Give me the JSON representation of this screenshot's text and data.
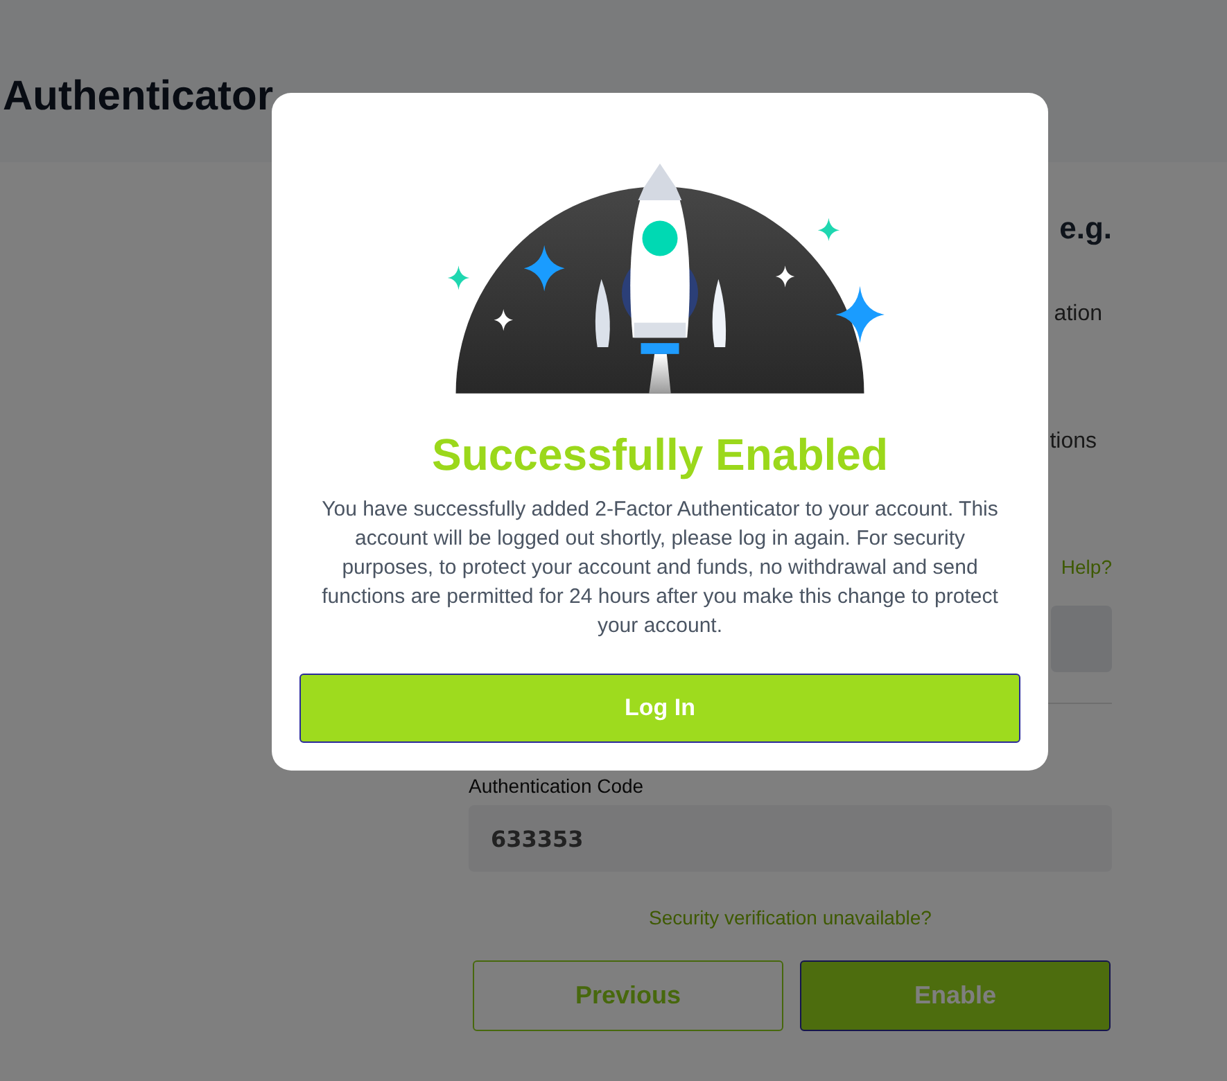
{
  "page": {
    "title": "Authenticator",
    "section_heading": "e.g.",
    "text_1": "ation",
    "text_2": "tions",
    "help_link": "Help?",
    "code_label": "Authentication Code",
    "code_value": "633353",
    "unavailable_link": "Security verification unavailable?",
    "buttons": [
      {
        "label": "Previous",
        "kind": "secondary"
      },
      {
        "label": "Enable",
        "kind": "primary"
      }
    ]
  },
  "dialog": {
    "title": "Successfully Enabled",
    "message": "You have successfully added 2-Factor Authenticator to your account. This account will be logged out shortly, please log in again. For security purposes, to protect your account and funds, no withdrawal and send functions are permitted for 24 hours after you make this change to protect your account.",
    "button": "Log In"
  }
}
